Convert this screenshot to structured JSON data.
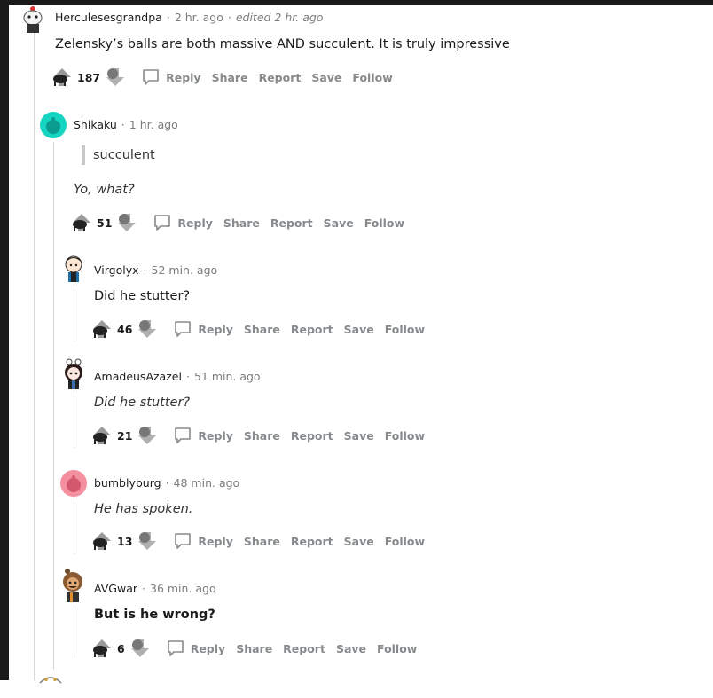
{
  "comments": [
    {
      "author": "Herculesesgrandpa",
      "time": "2 hr. ago",
      "edited": "edited 2 hr. ago",
      "body": "Zelensky’s balls are both massive AND succulent. It is truly impressive",
      "score": "187"
    },
    {
      "author": "Shikaku",
      "time": "1 hr. ago",
      "quote": "succulent",
      "body": "Yo, what?",
      "score": "51"
    },
    {
      "author": "Virgolyx",
      "time": "52 min. ago",
      "body": "Did he stutter?",
      "score": "46"
    },
    {
      "author": "AmadeusAzazel",
      "time": "51 min. ago",
      "body": "Did he stutter?",
      "score": "21"
    },
    {
      "author": "bumblyburg",
      "time": "48 min. ago",
      "body": "He has spoken.",
      "score": "13"
    },
    {
      "author": "AVGwar",
      "time": "36 min. ago",
      "body": "But is he wrong?",
      "score": "6"
    }
  ],
  "actions": {
    "reply": "Reply",
    "share": "Share",
    "report": "Report",
    "save": "Save",
    "follow": "Follow"
  },
  "separator": "·",
  "colors": {
    "shikaku_avatar": "#15d4c2",
    "bumblyburg_avatar": "#f48fa0",
    "thread_line": "#d6d6d6",
    "action_text": "#878a8c"
  }
}
